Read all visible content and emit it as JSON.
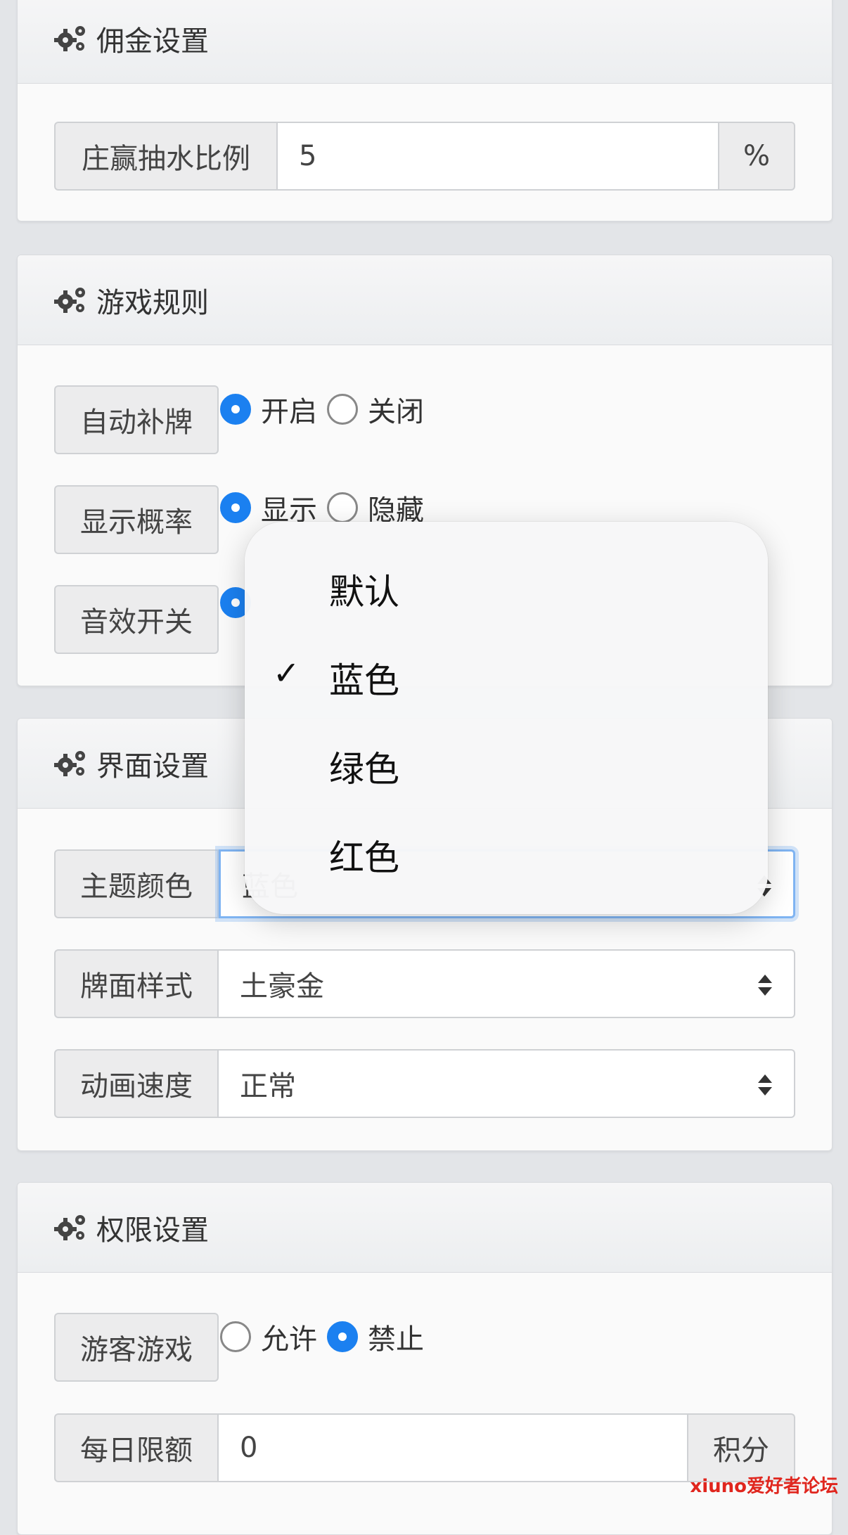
{
  "sections": [
    {
      "title": "佣金设置"
    },
    {
      "title": "游戏规则"
    },
    {
      "title": "界面设置"
    },
    {
      "title": "权限设置"
    }
  ],
  "commission": {
    "label": "庄赢抽水比例",
    "value": "5",
    "suffix": "%"
  },
  "rules": {
    "auto_deal": {
      "label": "自动补牌",
      "options": [
        "开启",
        "关闭"
      ],
      "selected": "开启"
    },
    "show_prob": {
      "label": "显示概率",
      "options": [
        "显示",
        "隐藏"
      ],
      "selected": "显示"
    },
    "sound": {
      "label": "音效开关",
      "options": [],
      "selected": "on"
    }
  },
  "ui": {
    "theme": {
      "label": "主题颜色",
      "value": "蓝色"
    },
    "card_style": {
      "label": "牌面样式",
      "value": "土豪金"
    },
    "anim_speed": {
      "label": "动画速度",
      "value": "正常"
    }
  },
  "perm": {
    "guest": {
      "label": "游客游戏",
      "options": [
        "允许",
        "禁止"
      ],
      "selected": "禁止"
    },
    "daily": {
      "label": "每日限额",
      "value": "0",
      "suffix": "积分"
    }
  },
  "dropdown": {
    "options": [
      "默认",
      "蓝色",
      "绿色",
      "红色"
    ],
    "selected": "蓝色",
    "check": "✓"
  },
  "watermark": "xiuno爱好者论坛",
  "colors": {
    "accent": "#1b80f0",
    "focus": "#7fb4f2",
    "watermark": "#e0261e"
  }
}
